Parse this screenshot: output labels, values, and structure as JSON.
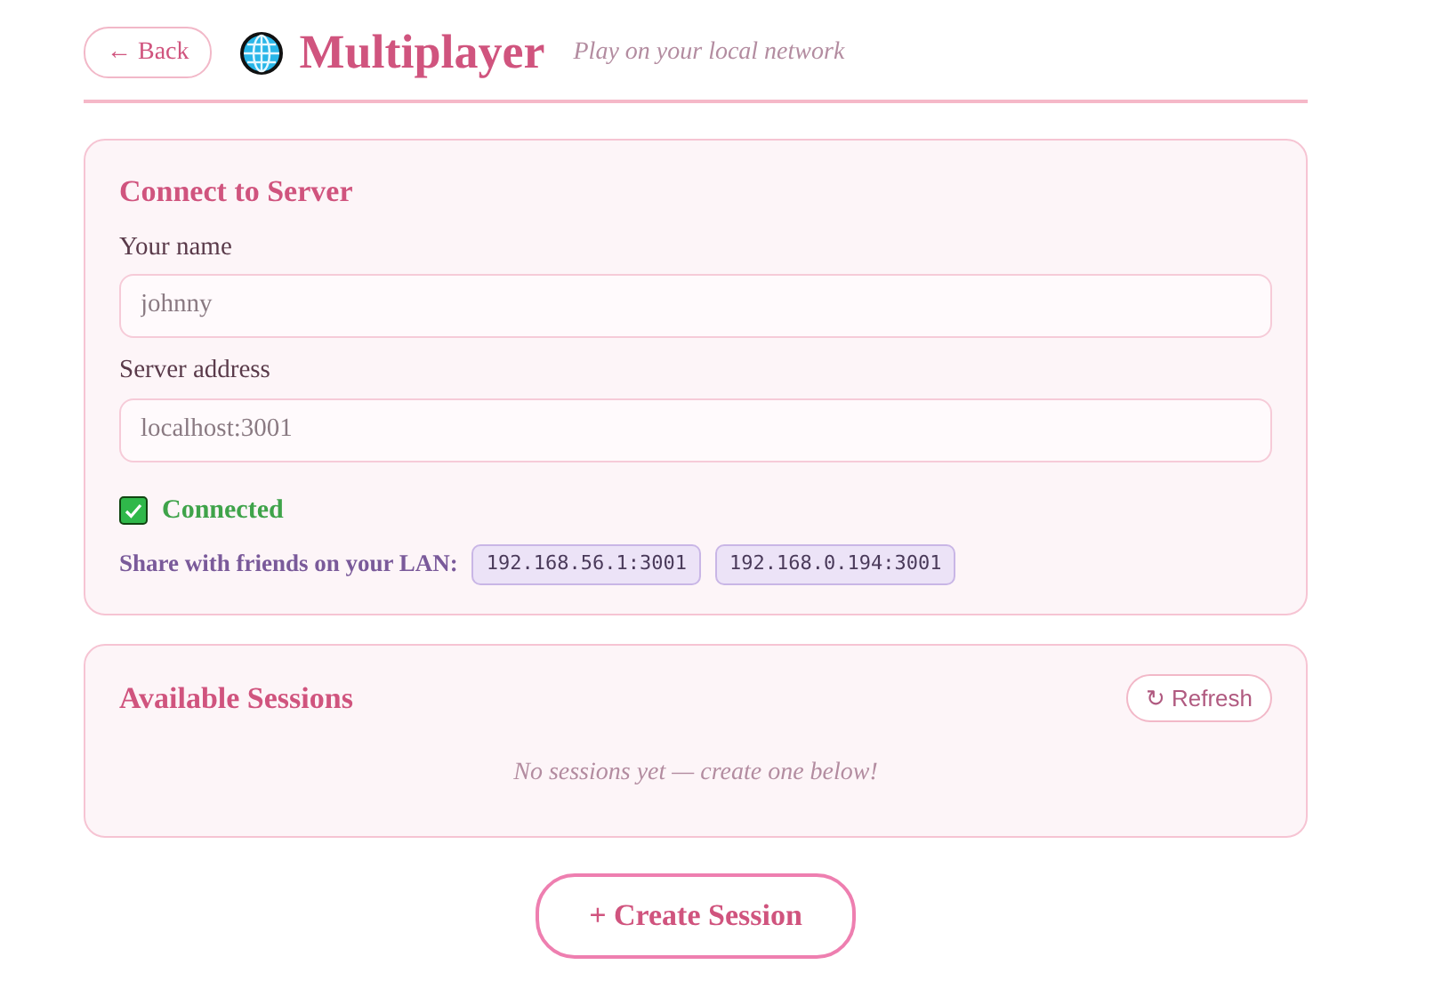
{
  "header": {
    "back_button": "← Back",
    "title": "Multiplayer",
    "subtitle": "Play on your local network"
  },
  "connect_card": {
    "title": "Connect to Server",
    "fields": [
      {
        "label": "Your name",
        "value": "johnny"
      },
      {
        "label": "Server address",
        "value": "localhost:3001"
      }
    ],
    "status": {
      "connected": true,
      "label": "Connected"
    },
    "share_label": "Share with friends on your LAN:",
    "addresses": [
      "192.168.56.1:3001",
      "192.168.0.194:3001"
    ]
  },
  "sessions_card": {
    "title": "Available Sessions",
    "refresh_button": "↻ Refresh",
    "empty_message": "No sessions yet — create one below!"
  },
  "create_button": "+ Create Session"
}
